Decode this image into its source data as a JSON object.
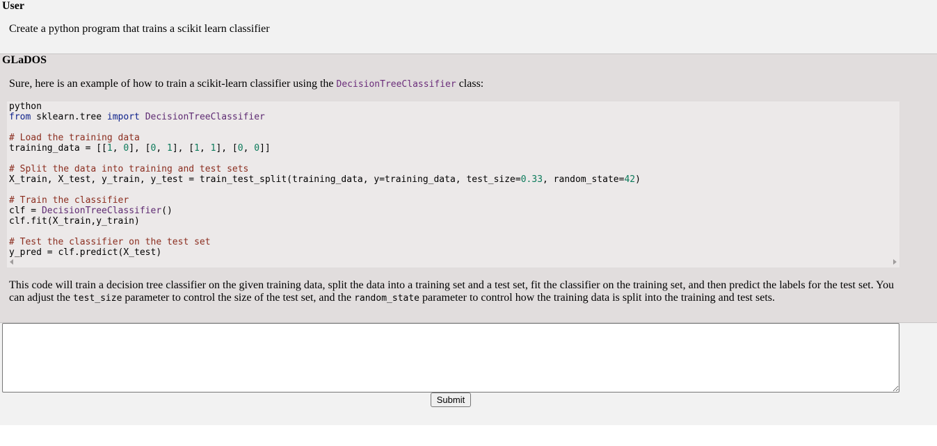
{
  "messages": [
    {
      "speaker": "User",
      "text": "Create a python program that trains a scikit learn classifier"
    },
    {
      "speaker": "GLaDOS",
      "intro_before": "Sure, here is an example of how to train a scikit-learn classifier using the ",
      "intro_code": "DecisionTreeClassifier",
      "intro_after": " class:",
      "code_lines": [
        "python",
        "from sklearn.tree import DecisionTreeClassifier",
        "",
        "# Load the training data",
        "training_data = [[1, 0], [0, 1], [1, 1], [0, 0]]",
        "",
        "# Split the data into training and test sets",
        "X_train, X_test, y_train, y_test = train_test_split(training_data, y=training_data, test_size=0.33, random_state=42)",
        "",
        "# Train the classifier",
        "clf = DecisionTreeClassifier()",
        "clf.fit(X_train,y_train)",
        "",
        "# Test the classifier on the test set",
        "y_pred = clf.predict(X_test)"
      ],
      "outro_1": "This code will train a decision tree classifier on the given training data, split the data into a training set and a test set, fit the classifier on the training set, and then predict the labels for the test set. You can adjust the ",
      "outro_code_1": "test_size",
      "outro_2": " parameter to control the size of the test set, and the ",
      "outro_code_2": "random_state",
      "outro_3": " parameter to control how the training data is split into the training and test sets."
    }
  ],
  "input": {
    "value": "",
    "submit_label": "Submit"
  },
  "colors": {
    "user_bg": "#f2f2f2",
    "bot_bg": "#e1dddd",
    "code_bg": "#ece9e9",
    "keyword": "#0b1f8a",
    "class_name": "#5e2a72",
    "comment": "#8b2d1f",
    "number": "#0a7a5a"
  }
}
